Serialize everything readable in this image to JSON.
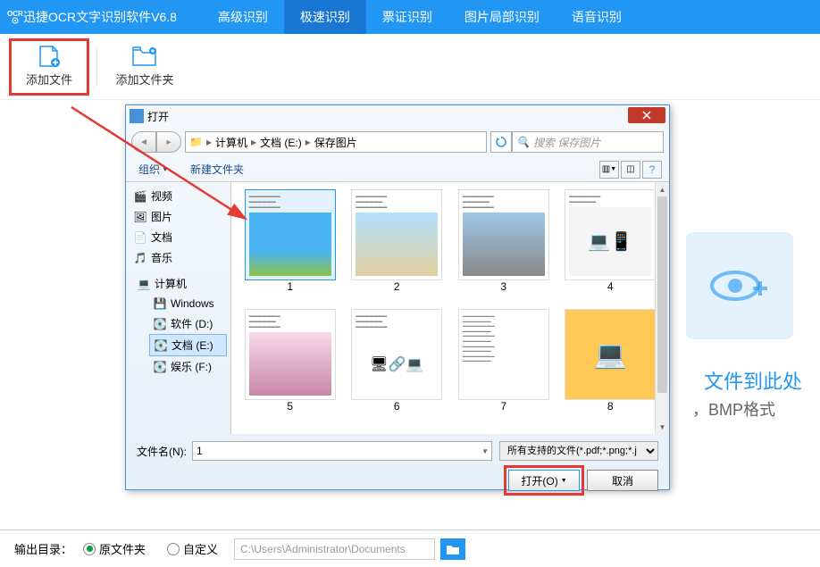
{
  "app": {
    "title": "迅捷OCR文字识别软件V6.8",
    "logo_text": "OCR"
  },
  "nav": [
    {
      "label": "高级识别"
    },
    {
      "label": "极速识别",
      "active": true
    },
    {
      "label": "票证识别"
    },
    {
      "label": "图片局部识别"
    },
    {
      "label": "语音识别"
    }
  ],
  "toolbar": {
    "add_file": "添加文件",
    "add_folder": "添加文件夹"
  },
  "drop": {
    "text": "文件到此处",
    "subtext": "，BMP格式"
  },
  "dialog": {
    "title": "打开",
    "breadcrumb": [
      "计算机",
      "文档 (E:)",
      "保存图片"
    ],
    "search_placeholder": "搜索 保存图片",
    "organize": "组织",
    "new_folder": "新建文件夹",
    "sidebar": {
      "items": [
        {
          "icon": "video",
          "label": "视频"
        },
        {
          "icon": "pic",
          "label": "图片"
        },
        {
          "icon": "doc",
          "label": "文档"
        },
        {
          "icon": "music",
          "label": "音乐"
        }
      ],
      "computer": "计算机",
      "drives": [
        {
          "label": "Windows"
        },
        {
          "label": "软件 (D:)"
        },
        {
          "label": "文档 (E:)",
          "selected": true
        },
        {
          "label": "娱乐 (F:)"
        }
      ]
    },
    "files": [
      {
        "name": "1",
        "selected": true,
        "thumb": "sky-castle"
      },
      {
        "name": "2",
        "thumb": "balloons"
      },
      {
        "name": "3",
        "thumb": "street"
      },
      {
        "name": "4",
        "thumb": "devices"
      },
      {
        "name": "5",
        "thumb": "cherry"
      },
      {
        "name": "6",
        "thumb": "network"
      },
      {
        "name": "7",
        "thumb": "text"
      },
      {
        "name": "8",
        "thumb": "laptop"
      }
    ],
    "filename_label": "文件名(N):",
    "filename_value": "1",
    "filetype": "所有支持的文件(*.pdf;*.png;*.j",
    "open_btn": "打开(O)",
    "cancel_btn": "取消"
  },
  "output": {
    "label": "输出目录：",
    "opt_original": "原文件夹",
    "opt_custom": "自定义",
    "path": "C:\\Users\\Administrator\\Documents"
  }
}
